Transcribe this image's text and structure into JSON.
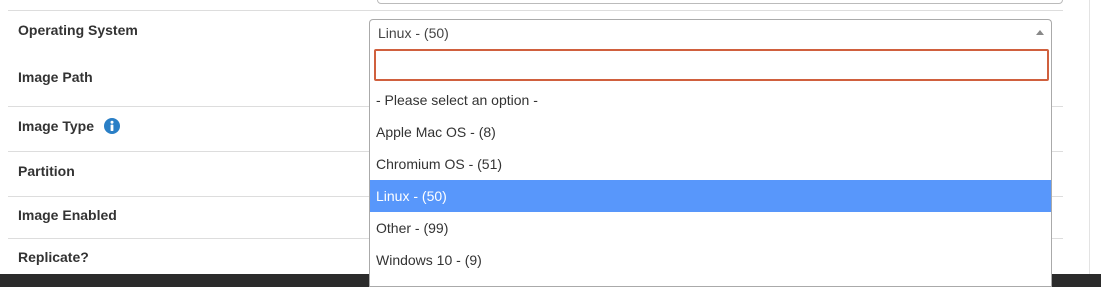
{
  "form": {
    "rows": [
      {
        "label": "Operating System"
      },
      {
        "label": "Image Path"
      },
      {
        "label": "Image Type"
      },
      {
        "label": "Partition"
      },
      {
        "label": "Image Enabled"
      },
      {
        "label": "Replicate?"
      }
    ],
    "image_type_icon": "info-icon"
  },
  "os_select": {
    "selected_value": "Linux - (50)",
    "search_value": "",
    "options": [
      {
        "label": "- Please select an option -"
      },
      {
        "label": "Apple Mac OS - (8)"
      },
      {
        "label": "Chromium OS - (51)"
      },
      {
        "label": "Linux - (50)",
        "selected": true
      },
      {
        "label": "Other - (99)"
      },
      {
        "label": "Windows 10 - (9)"
      }
    ]
  },
  "colors": {
    "highlight": "#5897fb",
    "search_focus_border": "#d0603e",
    "info_icon": "#2a7fc6"
  }
}
